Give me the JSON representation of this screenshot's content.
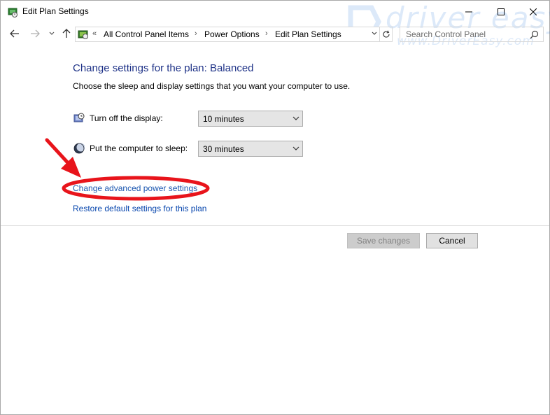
{
  "window": {
    "title": "Edit Plan Settings",
    "minimize_icon": "minimize-icon",
    "maximize_icon": "maximize-icon",
    "close_icon": "close-icon"
  },
  "navigation": {
    "back_icon": "back-arrow-icon",
    "forward_icon": "forward-arrow-icon",
    "recent_icon": "chevron-down-icon",
    "up_icon": "up-arrow-icon",
    "overflow": "«",
    "breadcrumbs": [
      "All Control Panel Items",
      "Power Options",
      "Edit Plan Settings"
    ],
    "separator": "›",
    "search_placeholder": "Search Control Panel"
  },
  "watermark": {
    "brand": "driver easy",
    "url": "www.DriverEasy.com"
  },
  "content": {
    "heading": "Change settings for the plan: Balanced",
    "subheading": "Choose the sleep and display settings that you want your computer to use.",
    "settings": [
      {
        "label": "Turn off the display:",
        "value": "10 minutes",
        "icon": "display-icon"
      },
      {
        "label": "Put the computer to sleep:",
        "value": "30 minutes",
        "icon": "sleep-moon-icon"
      }
    ],
    "links": {
      "advanced": "Change advanced power settings",
      "restore": "Restore default settings for this plan"
    }
  },
  "buttons": {
    "save": "Save changes",
    "cancel": "Cancel"
  },
  "colors": {
    "heading": "#1e3287",
    "link": "#0645ad",
    "annotation_red": "#e8141b"
  }
}
